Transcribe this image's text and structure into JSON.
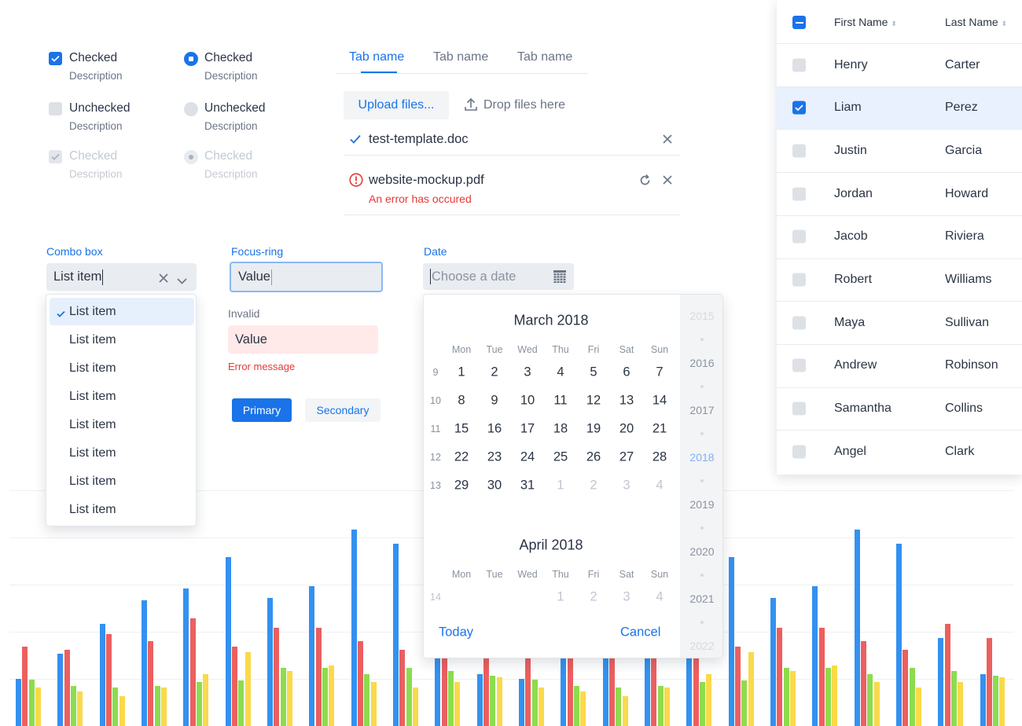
{
  "checkboxes": [
    {
      "label": "Checked",
      "description": "Description",
      "state": "checked"
    },
    {
      "label": "Unchecked",
      "description": "Description",
      "state": "unchecked"
    },
    {
      "label": "Checked",
      "description": "Description",
      "state": "disabled-checked"
    }
  ],
  "radios": [
    {
      "label": "Checked",
      "description": "Description",
      "state": "checked"
    },
    {
      "label": "Unchecked",
      "description": "Description",
      "state": "unchecked"
    },
    {
      "label": "Checked",
      "description": "Description",
      "state": "disabled-checked"
    }
  ],
  "tabs": [
    {
      "label": "Tab name",
      "active": true
    },
    {
      "label": "Tab name"
    },
    {
      "label": "Tab name"
    }
  ],
  "upload": {
    "button_label": "Upload files...",
    "drop_label": "Drop files here",
    "files": [
      {
        "name": "test-template.doc",
        "status": "success"
      },
      {
        "name": "website-mockup.pdf",
        "status": "error",
        "error": "An error has occured"
      }
    ]
  },
  "combo": {
    "label": "Combo box",
    "value": "List item",
    "options": [
      "List item",
      "List item",
      "List item",
      "List item",
      "List item",
      "List item",
      "List item",
      "List item"
    ],
    "selected_index": 0
  },
  "focus_field": {
    "label": "Focus-ring",
    "value": "Value"
  },
  "invalid_field": {
    "label": "Invalid",
    "value": "Value",
    "error": "Error message"
  },
  "buttons": {
    "primary": "Primary",
    "secondary": "Secondary"
  },
  "date": {
    "label": "Date",
    "placeholder": "Choose a date",
    "weekdays": [
      "Mon",
      "Tue",
      "Wed",
      "Thu",
      "Fri",
      "Sat",
      "Sun"
    ],
    "months": [
      {
        "title": "March 2018",
        "weeks": [
          {
            "n": "9",
            "days": [
              "1",
              "2",
              "3",
              "4",
              "5",
              "6",
              "7"
            ],
            "muted_from": 7
          },
          {
            "n": "10",
            "days": [
              "8",
              "9",
              "10",
              "11",
              "12",
              "13",
              "14"
            ],
            "muted_from": 7
          },
          {
            "n": "11",
            "days": [
              "15",
              "16",
              "17",
              "18",
              "19",
              "20",
              "21"
            ],
            "muted_from": 7
          },
          {
            "n": "12",
            "days": [
              "22",
              "23",
              "24",
              "25",
              "26",
              "27",
              "28"
            ],
            "muted_from": 7
          },
          {
            "n": "13",
            "days": [
              "29",
              "30",
              "31",
              "1",
              "2",
              "3",
              "4"
            ],
            "muted_from": 3
          }
        ]
      },
      {
        "title": "April 2018",
        "weeks": [
          {
            "n": "14",
            "days": [
              "",
              "",
              "",
              "1",
              "2",
              "3",
              "4"
            ],
            "muted_from": 0
          }
        ]
      }
    ],
    "years": [
      "2015",
      "2016",
      "2017",
      "2018",
      "2019",
      "2020",
      "2021",
      "2022"
    ],
    "selected_year": "2018",
    "today_label": "Today",
    "cancel_label": "Cancel"
  },
  "table": {
    "columns": [
      "First Name",
      "Last Name"
    ],
    "rows": [
      {
        "first": "Henry",
        "last": "Carter"
      },
      {
        "first": "Liam",
        "last": "Perez",
        "selected": true
      },
      {
        "first": "Justin",
        "last": "Garcia"
      },
      {
        "first": "Jordan",
        "last": "Howard"
      },
      {
        "first": "Jacob",
        "last": "Riviera"
      },
      {
        "first": "Robert",
        "last": "Williams"
      },
      {
        "first": "Maya",
        "last": "Sullivan"
      },
      {
        "first": "Andrew",
        "last": "Robinson"
      },
      {
        "first": "Samantha",
        "last": "Collins"
      },
      {
        "first": "Angel",
        "last": "Clark"
      }
    ]
  },
  "colors": {
    "accent": "#1a73e8",
    "error": "#e53935",
    "series": [
      "#3391f0",
      "#ec5f5f",
      "#8cdc4f",
      "#fad94a"
    ]
  },
  "background_chart": {
    "type": "bar",
    "grid": true,
    "groups": [
      [
        1.0,
        1.68,
        0.98,
        0.82
      ],
      [
        1.53,
        1.62,
        0.85,
        0.73
      ],
      [
        2.17,
        1.95,
        0.82,
        0.63
      ],
      [
        2.67,
        1.8,
        0.85,
        0.82
      ],
      [
        2.92,
        2.28,
        0.93,
        1.1
      ],
      [
        3.58,
        1.68,
        0.97,
        1.57
      ],
      [
        2.72,
        2.08,
        1.23,
        1.17
      ],
      [
        2.97,
        2.08,
        1.23,
        1.28
      ],
      [
        4.17,
        1.8,
        1.1,
        0.93
      ],
      [
        3.87,
        1.62,
        1.23,
        0.82
      ],
      [
        1.87,
        2.17,
        1.17,
        0.93
      ],
      [
        1.1,
        1.87,
        1.07,
        1.03
      ],
      [
        1.0,
        1.68,
        0.98,
        0.82
      ],
      [
        1.53,
        1.62,
        0.85,
        0.73
      ],
      [
        2.17,
        1.95,
        0.82,
        0.63
      ],
      [
        2.67,
        1.8,
        0.85,
        0.82
      ],
      [
        2.92,
        2.28,
        0.93,
        1.1
      ],
      [
        3.58,
        1.68,
        0.97,
        1.57
      ],
      [
        2.72,
        2.08,
        1.23,
        1.17
      ],
      [
        2.97,
        2.08,
        1.23,
        1.28
      ],
      [
        4.17,
        1.8,
        1.1,
        0.93
      ],
      [
        3.87,
        1.62,
        1.23,
        0.82
      ],
      [
        1.87,
        2.17,
        1.17,
        0.93
      ],
      [
        1.1,
        1.87,
        1.07,
        1.03
      ]
    ]
  }
}
